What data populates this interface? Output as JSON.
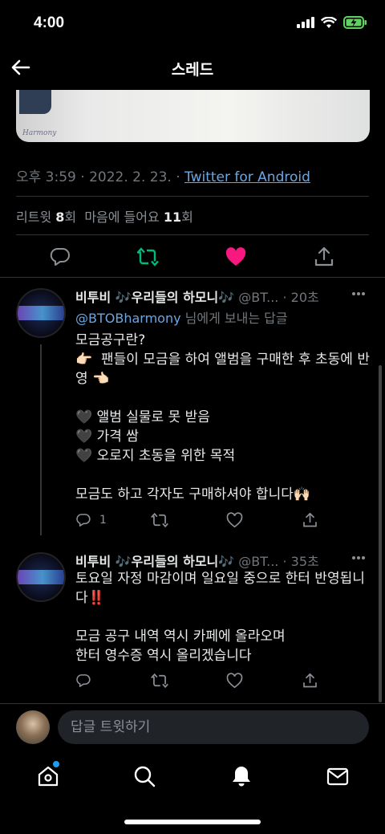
{
  "status_bar": {
    "time": "4:00"
  },
  "header": {
    "title": "스레드"
  },
  "tweet": {
    "timestamp": "오후 3:59 · 2022. 2. 23. · ",
    "source": "Twitter for Android",
    "retweet_label": "리트윗",
    "retweet_count": "8",
    "retweet_unit": "회",
    "like_label": "마음에 들어요",
    "like_count": "11",
    "like_unit": "회",
    "media_signature": "Harmony"
  },
  "replies": [
    {
      "name": "비투비 🎶우리들의 하모니🎶",
      "handle": "@BT...",
      "time": "· 20초",
      "replying_handle": "@BTOBharmony",
      "replying_suffix": " 님에게 보내는 답글",
      "text": "모금공구란?\n👉🏻  팬들이 모금을 하여 앨범을 구매한 후 초동에 반영 👈🏻\n\n🖤 앨범 실물로 못 받음\n🖤 가격 쌈\n🖤 오로지 초동을 위한 목적\n\n모금도 하고 각자도 구매하셔야 합니다🙌🏻",
      "reply_count": "1"
    },
    {
      "name": "비투비 🎶우리들의 하모니🎶",
      "handle": "@BT...",
      "time": "· 35초",
      "text": "토요일 자정 마감이며 일요일 중으로 한터 반영됩니다‼️\n\n모금 공구 내역 역시 카페에 올라오며\n한터 영수증 역시 올리겠습니다",
      "reply_count": ""
    }
  ],
  "compose": {
    "placeholder": "답글 트윗하기"
  },
  "colors": {
    "accent": "#1d9bf0",
    "retweet": "#00ba7c",
    "like": "#f91880",
    "link": "#6aa6e4"
  }
}
